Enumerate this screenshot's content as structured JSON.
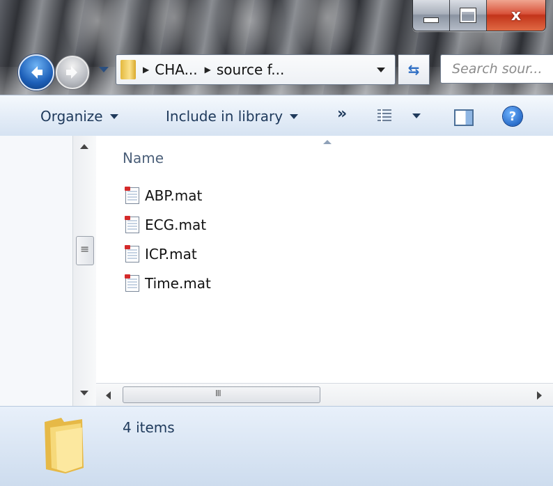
{
  "address": {
    "crumbs": [
      "CHA...",
      "source f..."
    ]
  },
  "search": {
    "placeholder": "Search sour..."
  },
  "toolbar": {
    "organize": "Organize",
    "include_in_library": "Include in library",
    "more": "»"
  },
  "list": {
    "column_name": "Name",
    "files": [
      {
        "name": "ABP.mat"
      },
      {
        "name": "ECG.mat"
      },
      {
        "name": "ICP.mat"
      },
      {
        "name": "Time.mat"
      }
    ]
  },
  "details": {
    "item_count": "4 items"
  },
  "caption": {
    "close": "x"
  }
}
